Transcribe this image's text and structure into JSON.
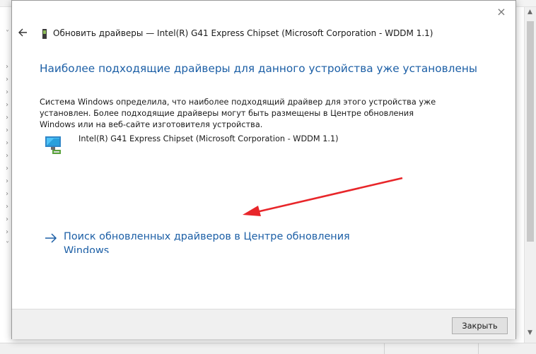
{
  "dialog": {
    "title": "Обновить драйверы — Intel(R) G41 Express Chipset (Microsoft Corporation - WDDM 1.1)",
    "heading": "Наиболее подходящие драйверы для данного устройства уже установлены",
    "description_lines": [
      "Система Windows определила, что наиболее подходящий драйвер для этого устройства уже",
      "установлен. Более подходящие драйверы могут быть размещены в Центре обновления",
      "Windows или на веб-сайте изготовителя устройства."
    ],
    "device_name": "Intel(R) G41 Express Chipset (Microsoft Corporation - WDDM 1.1)",
    "link_text": "Поиск обновленных драйверов в Центре обновления Windows",
    "close_button_label": "Закрыть",
    "close_glyph": "×",
    "back_icon": "back-arrow-icon"
  },
  "colors": {
    "accent": "#1c5fa6",
    "annotation_arrow": "#e8262a"
  }
}
